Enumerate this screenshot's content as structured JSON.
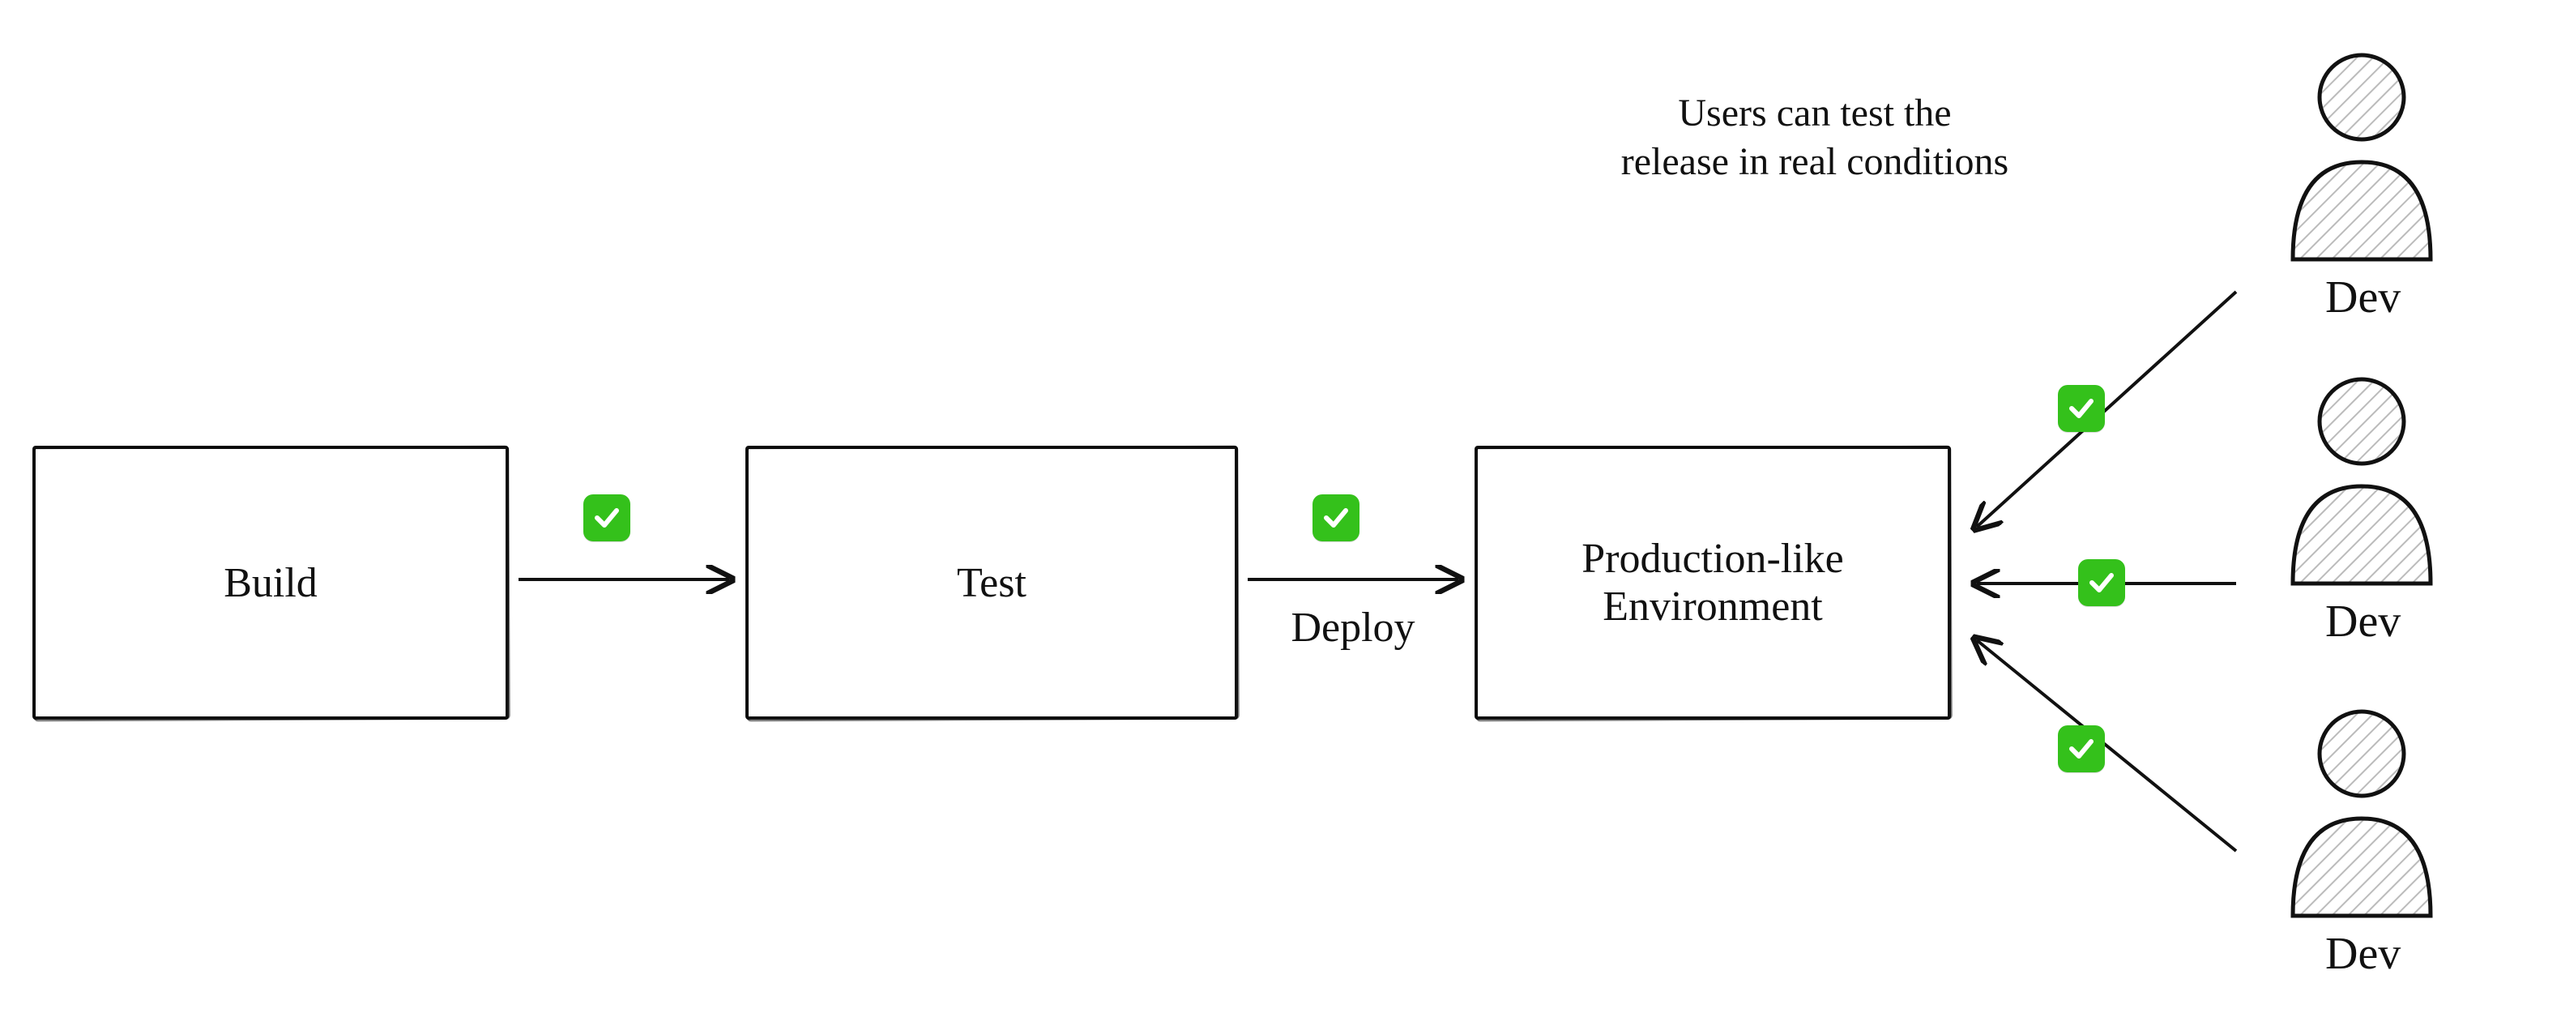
{
  "boxes": {
    "build": "Build",
    "test": "Test",
    "prodlike": "Production-like\nEnvironment"
  },
  "arrows": {
    "deploy_label": "Deploy"
  },
  "caption": {
    "text": "Users can test the\nrelease in real conditions"
  },
  "actors": {
    "dev1": "Dev",
    "dev2": "Dev",
    "dev3": "Dev"
  },
  "check_icon_name": "check-icon"
}
